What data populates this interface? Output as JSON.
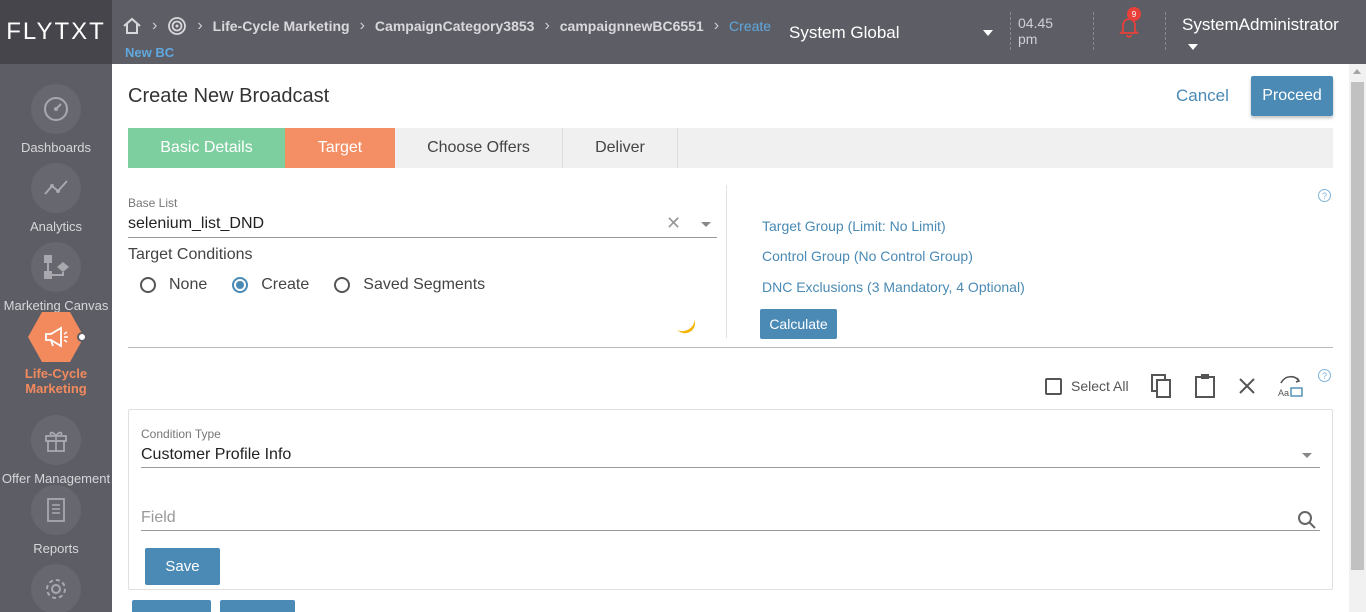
{
  "app": {
    "logo": "FLYTXT"
  },
  "header": {
    "breadcrumbs": [
      "Life-Cycle Marketing",
      "CampaignCategory3853",
      "campaignnewBC6551"
    ],
    "current_crumb": "Create",
    "current_crumb_line2": "New BC",
    "scope": "System Global",
    "time_line1": "04.45",
    "time_line2": "pm",
    "notification_count": "9",
    "user": "SystemAdministrator"
  },
  "sidebar": {
    "items": [
      {
        "label": "Dashboards",
        "icon": "gauge-icon"
      },
      {
        "label": "Analytics",
        "icon": "line-chart-icon"
      },
      {
        "label": "Marketing Canvas",
        "icon": "flow-icon"
      },
      {
        "label_line1": "Life-Cycle",
        "label_line2": "Marketing",
        "icon": "megaphone-icon",
        "active": true
      },
      {
        "label": "Offer Management",
        "icon": "gift-icon"
      },
      {
        "label": "Reports",
        "icon": "document-icon"
      },
      {
        "label": "",
        "icon": "gear-icon"
      }
    ]
  },
  "page": {
    "title": "Create New Broadcast",
    "cancel_label": "Cancel",
    "proceed_label": "Proceed"
  },
  "steps": [
    "Basic Details",
    "Target",
    "Choose Offers",
    "Deliver"
  ],
  "target": {
    "base_list_label": "Base List",
    "base_list_value": "selenium_list_DND",
    "conditions_title": "Target Conditions",
    "radio_options": [
      "None",
      "Create",
      "Saved Segments"
    ],
    "selected_option": "Create",
    "target_group_link": "Target Group (Limit: No Limit)",
    "control_group_link": "Control Group (No Control Group)",
    "dnc_link": "DNC Exclusions (3 Mandatory, 4 Optional)",
    "calculate_label": "Calculate",
    "help_glyph": "?"
  },
  "toolbar": {
    "select_all_label": "Select All",
    "icons": [
      "copy-icon",
      "paste-icon",
      "close-icon",
      "text-image-icon"
    ]
  },
  "condition": {
    "type_label": "Condition Type",
    "type_value": "Customer Profile Info",
    "field_placeholder": "Field",
    "save_label": "Save"
  },
  "colors": {
    "topbar": "#5d5d65",
    "accent_blue": "#4a8ab5",
    "step_done": "#7ecfa0",
    "step_active": "#f48e64",
    "active_nav": "#f28a5d"
  }
}
